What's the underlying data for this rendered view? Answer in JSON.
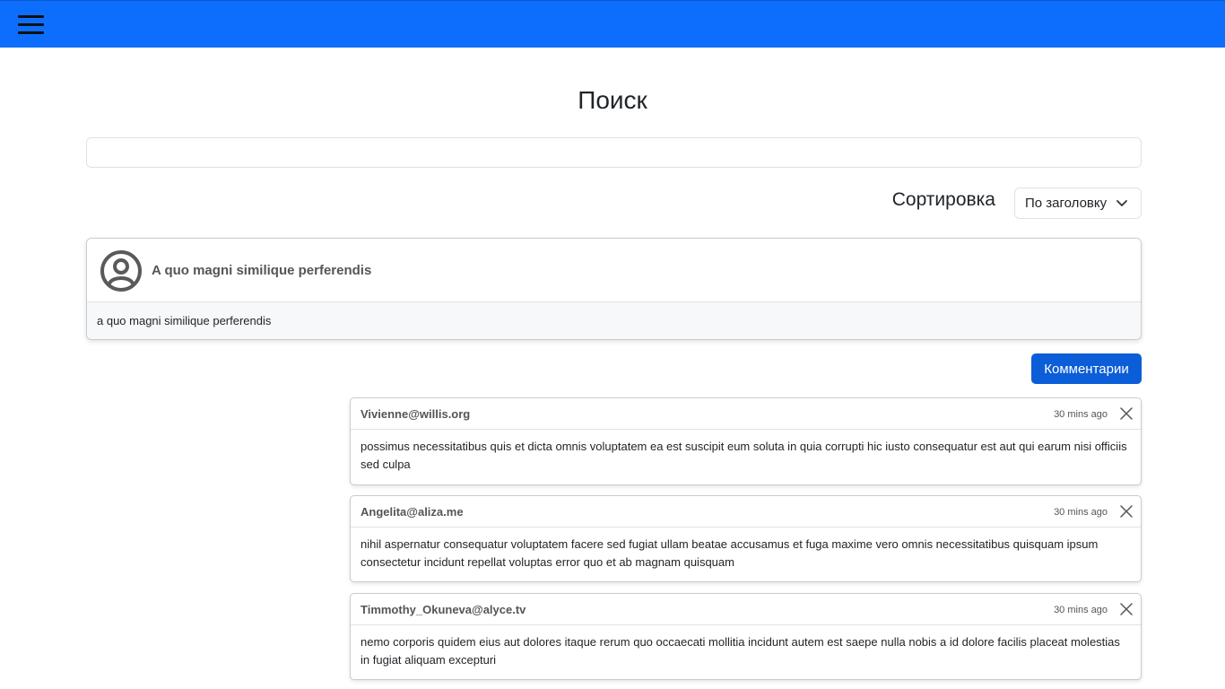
{
  "header": {
    "menu_icon": "hamburger-menu-icon"
  },
  "page": {
    "title": "Поиск"
  },
  "search": {
    "value": "",
    "placeholder": ""
  },
  "sort": {
    "label": "Сортировка",
    "selected": "По заголовку"
  },
  "post": {
    "title": "A quo magni similique perferendis",
    "body": "a quo magni similique perferendis",
    "avatar_icon": "user-circle-icon"
  },
  "comments_button": {
    "label": "Комментарии"
  },
  "comments": [
    {
      "email": "Vivienne@willis.org",
      "time": "30 mins ago",
      "body": "possimus necessitatibus quis et dicta omnis voluptatem ea est suscipit eum soluta in quia corrupti hic iusto consequatur est aut qui earum nisi officiis sed culpa"
    },
    {
      "email": "Angelita@aliza.me",
      "time": "30 mins ago",
      "body": "nihil aspernatur consequatur voluptatem facere sed fugiat ullam beatae accusamus et fuga maxime vero omnis necessitatibus quisquam ipsum consectetur incidunt repellat voluptas error quo et ab magnam quisquam"
    },
    {
      "email": "Timmothy_Okuneva@alyce.tv",
      "time": "30 mins ago",
      "body": "nemo corporis quidem eius aut dolores itaque rerum quo occaecati mollitia incidunt autem est saepe nulla nobis a id dolore facilis placeat molestias in fugiat aliquam excepturi"
    }
  ],
  "colors": {
    "navbar": "#0d6efd",
    "button": "#0b5ed7"
  }
}
